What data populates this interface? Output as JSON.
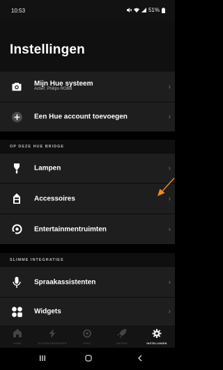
{
  "status": {
    "time": "10:53",
    "battery": "51%"
  },
  "header": {
    "title": "Instellingen"
  },
  "account": {
    "system_label": "Mijn Hue systeem",
    "system_sub": "Actief: Philips ROBB",
    "add_label": "Een Hue account toevoegen"
  },
  "bridge_section": {
    "heading": "OP DEZE HUE BRIDGE",
    "items": [
      {
        "label": "Lampen",
        "icon": "bulb-icon"
      },
      {
        "label": "Accessoires",
        "icon": "switch-icon"
      },
      {
        "label": "Entertainmentruimten",
        "icon": "entertainment-icon"
      }
    ]
  },
  "smart_section": {
    "heading": "SLIMME INTEGRATIES",
    "items": [
      {
        "label": "Spraakassistenten",
        "icon": "microphone-icon"
      },
      {
        "label": "Widgets",
        "icon": "widgets-icon"
      }
    ]
  },
  "bottom_nav": {
    "items": [
      {
        "label": "HOME",
        "icon": "home-icon"
      },
      {
        "label": "AUTOMATISERINGEN",
        "icon": "automation-icon"
      },
      {
        "label": "SYNC",
        "icon": "sync-icon"
      },
      {
        "label": "ONTDEK",
        "icon": "explore-icon"
      },
      {
        "label": "INSTELLINGEN",
        "icon": "settings-gear-icon"
      }
    ],
    "active_index": 4
  },
  "chevron": "›",
  "colors": {
    "accent_arrow": "#f08a24",
    "row_bg": "#1e1e1e",
    "background": "#000000"
  }
}
